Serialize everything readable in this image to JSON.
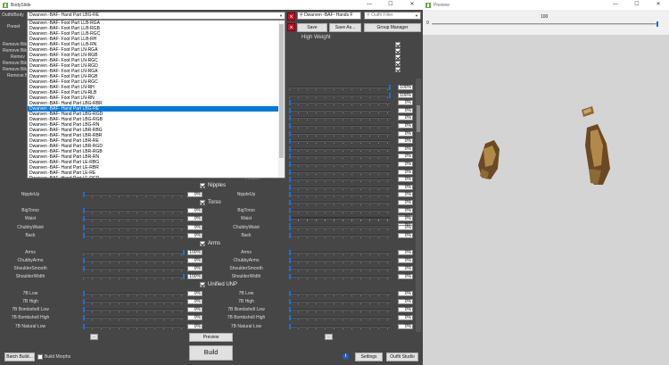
{
  "bodyslide": {
    "title": "BodySlide",
    "outfit_label": "Outfit/Body",
    "preset_label": "Preset",
    "outfit_value": "Dwarven -BAF- Hand Part LBG-RE",
    "search_value": "Dwarven -BAF- Hands F",
    "outfit_filter_placeholder": "Outfit Filter",
    "save_label": "Save",
    "save_as_label": "Save As...",
    "group_manager_label": "Group Manager",
    "high_weight_label": "High Weight",
    "left_partial_labels": [
      "Remove Bik",
      "Remove Bik",
      "Remov",
      "Remove Bik",
      "Remove Bik",
      "Remove B"
    ],
    "dropdown_items": [
      "Dwarven -BAF- Foot Part LLB-RGA",
      "Dwarven -BAF- Foot Part LLB-RGB",
      "Dwarven -BAF- Foot Part LLB-RGC",
      "Dwarven -BAF- Foot Part LLB-RH",
      "Dwarven -BAF- Foot Part LLB-RN",
      "Dwarven -BAF- Foot Part LN-RGA",
      "Dwarven -BAF- Foot Part LN-RGB",
      "Dwarven -BAF- Foot Part LN-RGC",
      "Dwarven -BAF- Foot Part LN-RGD",
      "Dwarven -BAF- Foot Part LN-RGA",
      "Dwarven -BAF- Foot Part LN-RGB",
      "Dwarven -BAF- Foot Part LN-RGC",
      "Dwarven -BAF- Foot Part LN-RH",
      "Dwarven -BAF- Foot Part LN-RLB",
      "Dwarven -BAF- Foot Part LN-RN",
      "Dwarven -BAF- Hand Part LBG-RBR",
      "Dwarven -BAF- Hand Part LBG-RE",
      "Dwarven -BAF- Hand Part LBG-RGD",
      "Dwarven -BAF- Hand Part LBG-RGB",
      "Dwarven -BAF- Hand Part LBG-RN",
      "Dwarven -BAF- Hand Part LBR-RBG",
      "Dwarven -BAF- Hand Part LBR-RBR",
      "Dwarven -BAF- Hand Part LBR-RE",
      "Dwarven -BAF- Hand Part LBR-RGD",
      "Dwarven -BAF- Hand Part LBR-RGB",
      "Dwarven -BAF- Hand Part LBR-RN",
      "Dwarven -BAF- Hand Part LE-RBG",
      "Dwarven -BAF- Hand Part LE-RBR",
      "Dwarven -BAF- Hand Part LE-RE",
      "Dwarven -BAF- Hand Part LE-RGD",
      "Dwarven -BAF- Hand Part LE-RGB"
    ],
    "dropdown_selected_index": 16,
    "upper_values_right": [
      "100%",
      "100%",
      "0%",
      "0%",
      "0%",
      "0%",
      "0%",
      "0%",
      "0%",
      "0%",
      "0%",
      "0%",
      "0%",
      "0%",
      "0%",
      "0%",
      "0%",
      "0%",
      "0%"
    ],
    "upper_values_right_levels": [
      1,
      1,
      0,
      0,
      0,
      0,
      0,
      0,
      0,
      0,
      0,
      0,
      0,
      0,
      0,
      0,
      0,
      0,
      0
    ],
    "partial_right_label": "lmiibble",
    "sections": [
      {
        "name": "Nipples",
        "rows": [
          {
            "left_label": "NippleUp",
            "right_label": "NippleUp",
            "left_value": "0%",
            "right_value": "0%",
            "left_level": 0,
            "right_level": 0
          }
        ]
      },
      {
        "name": "Torso",
        "rows": [
          {
            "left_label": "BigTorso",
            "right_label": "BigTorso",
            "left_value": "0%",
            "right_value": "0%",
            "left_level": 0,
            "right_level": 0
          },
          {
            "left_label": "Waist",
            "right_label": "Waist",
            "left_value": "0%",
            "right_value": "0%",
            "left_level": 0,
            "right_level": 0
          },
          {
            "left_label": "ChubbyWaist",
            "right_label": "ChubbyWaist",
            "left_value": "0%",
            "right_value": "0%",
            "left_level": 0,
            "right_level": 0
          },
          {
            "left_label": "Back",
            "right_label": "Back",
            "left_value": "0%",
            "right_value": "0%",
            "left_level": 0,
            "right_level": 0
          }
        ]
      },
      {
        "name": "Arms",
        "rows": [
          {
            "left_label": "Arms",
            "right_label": "Arms",
            "left_value": "100%",
            "right_value": "0%",
            "left_level": 1,
            "right_level": 0
          },
          {
            "left_label": "ChubbyArms",
            "right_label": "ChubbyArms",
            "left_value": "0%",
            "right_value": "0%",
            "left_level": 0,
            "right_level": 0
          },
          {
            "left_label": "ShoulderSmooth",
            "right_label": "ShoulderSmooth",
            "left_value": "0%",
            "right_value": "0%",
            "left_level": 0,
            "right_level": 0
          },
          {
            "left_label": "ShoulderWidth",
            "right_label": "ShoulderWidth",
            "left_value": "100%",
            "right_value": "0%",
            "left_level": 1,
            "right_level": 0
          }
        ]
      },
      {
        "name": "Unified UNP",
        "rows": [
          {
            "left_label": "7B Low",
            "right_label": "7B Low",
            "left_value": "0%",
            "right_value": "0%",
            "left_level": 0,
            "right_level": 0
          },
          {
            "left_label": "7B High",
            "right_label": "7B High",
            "left_value": "0%",
            "right_value": "0%",
            "left_level": 0,
            "right_level": 0
          },
          {
            "left_label": "7B Bombshell Low",
            "right_label": "7B Bombshell Low",
            "left_value": "0%",
            "right_value": "0%",
            "left_level": 0,
            "right_level": 0
          },
          {
            "left_label": "7B Bombshell High",
            "right_label": "7B Bombshell High",
            "left_value": "0%",
            "right_value": "0%",
            "left_level": 0,
            "right_level": 0
          },
          {
            "left_label": "7B Natural Low",
            "right_label": "7B Natural Low",
            "left_value": "0%",
            "right_value": "0%",
            "left_level": 0,
            "right_level": 0
          }
        ]
      }
    ],
    "ellipsis_label": "...",
    "preview_label": "Preview",
    "build_label": "Build",
    "batch_build_label": "Batch Build...",
    "build_morphs_label": "Build Morphs",
    "settings_label": "Settings",
    "outfit_studio_label": "Outfit Studio",
    "info_label": "i"
  },
  "preview": {
    "title": "Preview",
    "slider_min": "0",
    "slider_mid": "100",
    "slider_level": 1
  },
  "colors": {
    "panel": "#464646",
    "accent": "#0078d7",
    "slider_thumb": "#1a6fd8",
    "close_red": "#c8102e",
    "preview_bg": "#d4d4d4"
  }
}
